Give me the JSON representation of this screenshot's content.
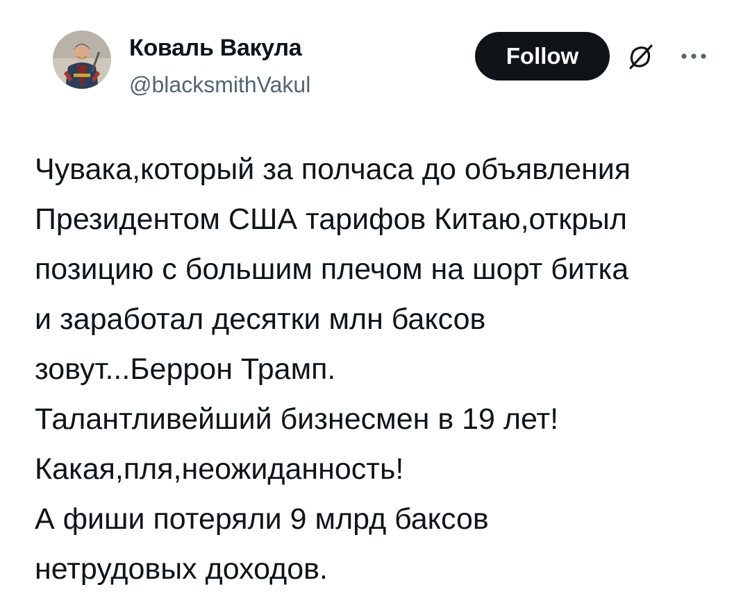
{
  "author": {
    "name": "Коваль Вакула",
    "handle": "@blacksmithVakul",
    "avatar_icon": "avatar-cossack-portrait"
  },
  "actions": {
    "follow_label": "Follow",
    "grok_icon": "grok-slash-icon",
    "more_icon": "more-dots-icon"
  },
  "tweet": {
    "lines": [
      "Чувака,который за полчаса до объявления",
      "Президентом США тарифов Китаю,открыл",
      "позицию с большим плечом на шорт битка",
      "и заработал десятки млн баксов",
      "зовут...Беррон Трамп.",
      "Талантливейший бизнесмен в 19 лет!",
      "Какая,пля,неожиданность!",
      "А фиши потеряли 9 млрд баксов",
      "нетрудовых доходов."
    ]
  },
  "colors": {
    "text_primary": "#0f1419",
    "text_secondary": "#536471",
    "button_bg": "#0f1419",
    "button_text": "#ffffff",
    "background": "#ffffff"
  }
}
